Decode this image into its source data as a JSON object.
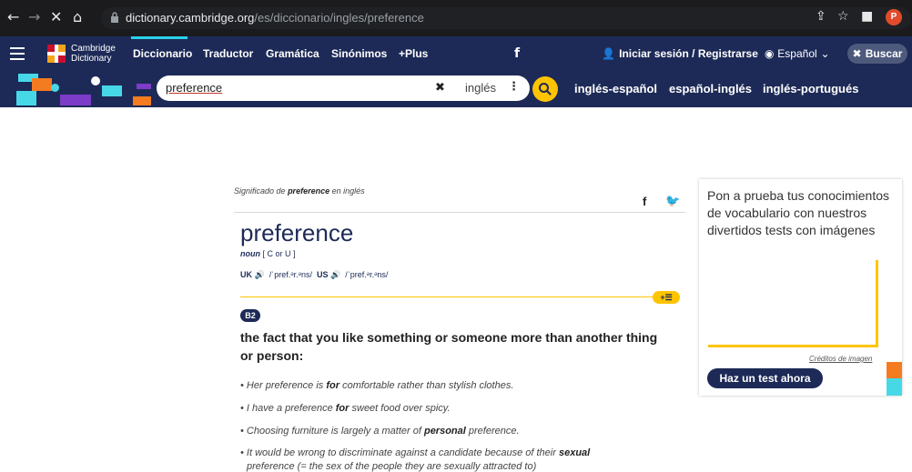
{
  "browser": {
    "url_host": "dictionary.cambridge.org",
    "url_path": "/es/diccionario/ingles/preference",
    "profile_initial": "P"
  },
  "nav": {
    "logo_line1": "Cambridge",
    "logo_line2": "Dictionary",
    "links": [
      "Diccionario",
      "Traductor",
      "Gramática",
      "Sinónimos",
      "+Plus"
    ],
    "login": "Iniciar sesión / Registrarse",
    "language": "Español",
    "buscar": "Buscar"
  },
  "search": {
    "query": "preference",
    "dictionary": "inglés",
    "dict_links": [
      "inglés-español",
      "español-inglés",
      "inglés-portugués"
    ]
  },
  "entry": {
    "meaning_prefix": "Significado de",
    "meaning_word": "preference",
    "meaning_suffix": "en inglés",
    "headword": "preference",
    "pos": "noun",
    "grammar": "[ C or U ]",
    "uk_label": "UK",
    "uk_ipa": "/ˈpref.ᵊr.ᵊns/",
    "us_label": "US",
    "us_ipa": "/ˈpref.ᵊr.ᵊns/",
    "level": "B2",
    "definition": "the fact that you like something or someone more than another thing or person:",
    "examples": [
      {
        "before": "Her preference is ",
        "bold": "for",
        "after": " comfortable rather than stylish clothes."
      },
      {
        "before": "I have a preference ",
        "bold": "for",
        "after": " sweet food over spicy."
      },
      {
        "before": "Choosing furniture is largely a matter of ",
        "bold": "personal",
        "after": " preference."
      },
      {
        "before": "It would be wrong to discriminate against a candidate because of their ",
        "bold": "sexual",
        "after": ""
      },
      {
        "before": "preference (= the sex of the people they are sexually attracted to)",
        "bold": "",
        "after": ""
      }
    ]
  },
  "quiz": {
    "title": "Pon a prueba tus conocimientos de vocabulario con nuestros divertidos tests con imágenes",
    "credit": "Créditos de imagen",
    "button": "Haz un test ahora"
  },
  "colors": {
    "brand_navy": "#1d2a57",
    "accent_yellow": "#fec400",
    "accent_cyan": "#2ad1e8",
    "accent_orange": "#f47b20"
  }
}
